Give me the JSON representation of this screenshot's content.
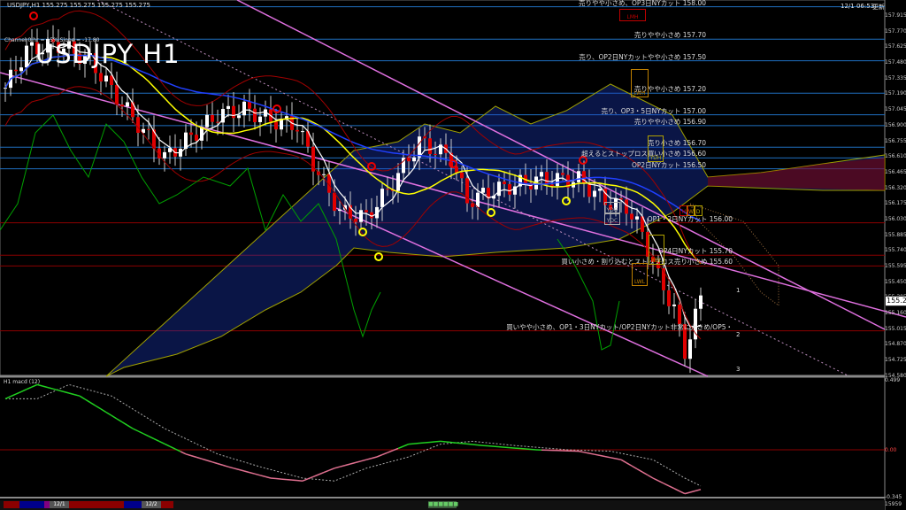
{
  "header": {
    "symbol_line": "USDJPY,H1  155.275  155.275  155.275  155.275",
    "datetime": "12/1 06:53",
    "status": "更新",
    "channel_info": "Channel 0 hr = 15% Slope = -17.80",
    "big_title": "USDJPY H1"
  },
  "price_axis": [
    "157.915",
    "157.770",
    "157.625",
    "157.480",
    "157.335",
    "157.190",
    "157.045",
    "156.900",
    "156.755",
    "156.610",
    "156.465",
    "156.320",
    "156.175",
    "156.030",
    "155.885",
    "155.740",
    "155.595",
    "155.450",
    "155.305",
    "155.160",
    "155.015",
    "154.870",
    "154.725",
    "154.580"
  ],
  "current_price": "155.275",
  "levels": [
    {
      "text": "売りやや小さめ、OP3日NYカット 158.00",
      "price": 158.0,
      "color": "#1f6fc0"
    },
    {
      "text": "売りやや小さめ 157.70",
      "price": 157.7,
      "color": "#1f6fc0"
    },
    {
      "text": "売り、OP2日NYカットやや小さめ 157.50",
      "price": 157.5,
      "color": "#1f6fc0"
    },
    {
      "text": "売りやや小さめ 157.20",
      "price": 157.2,
      "color": "#1f6fc0"
    },
    {
      "text": "売り、OP3・5日NYカット 157.00",
      "price": 157.0,
      "color": "#1f6fc0"
    },
    {
      "text": "売りやや小さめ 156.90",
      "price": 156.9,
      "color": "#1f6fc0"
    },
    {
      "text": "売り小さめ 156.70",
      "price": 156.7,
      "color": "#1f6fc0"
    },
    {
      "text": "超えるとストップロス買い小さめ 156.60",
      "price": 156.6,
      "color": "#1f6fc0"
    },
    {
      "text": "OP2日NYカット 156.50",
      "price": 156.5,
      "color": "#1f6fc0"
    },
    {
      "text": "OP1・2日NYカット 156.00",
      "price": 156.0,
      "color": "#8b0000"
    },
    {
      "text": "OP4日NYカット 155.70",
      "price": 155.7,
      "color": "#8b0000"
    },
    {
      "text": "買い小さめ・割り込むとストップロス売り小さめ 155.60",
      "price": 155.6,
      "color": "#8b0000"
    },
    {
      "text": "買いやや小さめ、OP1・3日NYカット/OP2日NYカット非常に大きめ/OP5・",
      "price": 155.0,
      "color": "#8b0000"
    }
  ],
  "boxes": [
    {
      "label": "LMH",
      "color": "#c00000"
    },
    {
      "label": "LWH",
      "color": "#c08000"
    },
    {
      "label": "YDH",
      "color": "#b0a000"
    },
    {
      "label": "YDO",
      "color": "#aaaaaa"
    },
    {
      "label": "YDC",
      "color": "#aaaaaa"
    },
    {
      "label": "YDL",
      "color": "#b0a000"
    },
    {
      "label": "LWL",
      "color": "#c08000"
    },
    {
      "label": "M",
      "color": "#c00000"
    },
    {
      "label": "W",
      "color": "#c08000"
    },
    {
      "label": "D",
      "color": "#b0a000"
    }
  ],
  "channel_marks": [
    "1",
    "2",
    "3"
  ],
  "macd": {
    "title": "H1  macd (12)",
    "axis": [
      "0.499",
      "0.00",
      "-0.345"
    ],
    "bottom": "15959"
  },
  "timeline": {
    "tabs": [
      "12/1",
      "12/2"
    ],
    "status_box": "■■■■■■"
  },
  "chart_data": {
    "type": "line",
    "close_waypoints": [
      [
        0,
        157.25
      ],
      [
        4,
        157.6
      ],
      [
        10,
        157.65
      ],
      [
        16,
        157.5
      ],
      [
        22,
        157.1
      ],
      [
        30,
        156.6
      ],
      [
        35,
        156.8
      ],
      [
        40,
        157.0
      ],
      [
        45,
        157.05
      ],
      [
        50,
        156.95
      ],
      [
        55,
        156.9
      ],
      [
        58,
        156.55
      ],
      [
        63,
        156.1
      ],
      [
        68,
        156.05
      ],
      [
        72,
        156.3
      ],
      [
        78,
        156.75
      ],
      [
        84,
        156.6
      ],
      [
        87,
        156.2
      ],
      [
        92,
        156.3
      ],
      [
        100,
        156.4
      ],
      [
        108,
        156.4
      ],
      [
        113,
        156.2
      ],
      [
        117,
        156.15
      ],
      [
        120,
        155.9
      ],
      [
        123,
        155.5
      ],
      [
        126,
        155.2
      ],
      [
        128,
        154.8
      ],
      [
        131,
        155.3
      ]
    ],
    "macd_waypoints": [
      [
        0,
        0.36
      ],
      [
        6,
        0.46
      ],
      [
        14,
        0.38
      ],
      [
        24,
        0.15
      ],
      [
        34,
        -0.03
      ],
      [
        42,
        -0.12
      ],
      [
        50,
        -0.2
      ],
      [
        56,
        -0.22
      ],
      [
        62,
        -0.13
      ],
      [
        70,
        -0.05
      ],
      [
        76,
        0.04
      ],
      [
        82,
        0.06
      ],
      [
        90,
        0.03
      ],
      [
        100,
        0.0
      ],
      [
        108,
        -0.01
      ],
      [
        116,
        -0.07
      ],
      [
        122,
        -0.2
      ],
      [
        128,
        -0.31
      ],
      [
        131,
        -0.28
      ]
    ]
  }
}
